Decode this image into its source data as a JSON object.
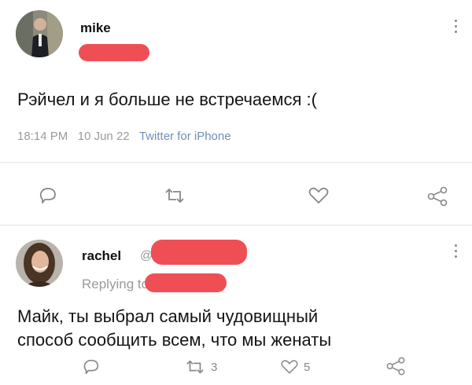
{
  "tweet1": {
    "author_name": "mike",
    "text": "Рэйчел и я больше не встречаемся :(",
    "time": "18:14 PM",
    "date": "10 Jun 22",
    "source": "Twitter for iPhone"
  },
  "tweet2": {
    "author_name": "rachel",
    "handle_prefix": "@",
    "replying_prefix": "Replying to",
    "text_line1": "Майк, ты выбрал самый чудовищный",
    "text_line2": "способ сообщить всем, что мы женаты",
    "retweet_count": "3",
    "like_count": "5"
  },
  "icons": {
    "reply": "reply-icon",
    "retweet": "retweet-icon",
    "like": "heart-icon",
    "share": "share-icon",
    "more": "more-vertical-icon"
  },
  "colors": {
    "redaction": "#ef4f54",
    "source_link": "#6f8fb8",
    "meta_gray": "#9a9a9a"
  }
}
